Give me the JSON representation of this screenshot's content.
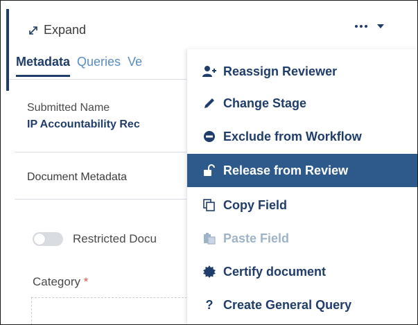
{
  "header": {
    "expand_label": "Expand",
    "icons": {
      "expand": "expand-arrows-icon",
      "more": "more-dots-icon",
      "caret": "chevron-down-icon"
    }
  },
  "tabs": [
    {
      "label": "Metadata",
      "active": true
    },
    {
      "label": "Queries",
      "active": false
    },
    {
      "label": "Ve",
      "active": false
    }
  ],
  "submitted": {
    "label": "Submitted Name",
    "value": "IP Accountability Rec"
  },
  "section_title": "Document Metadata",
  "restricted_toggle": {
    "label": "Restricted Docu",
    "on": false
  },
  "category": {
    "label": "Category",
    "required_mark": "*"
  },
  "menu": {
    "items": [
      {
        "label": "Reassign Reviewer",
        "icon": "user-plus-icon",
        "state": "normal"
      },
      {
        "label": "Change Stage",
        "icon": "pencil-icon",
        "state": "normal"
      },
      {
        "label": "Exclude from Workflow",
        "icon": "minus-circle-icon",
        "state": "normal"
      },
      {
        "label": "Release from Review",
        "icon": "unlock-icon",
        "state": "active"
      },
      {
        "label": "Copy Field",
        "icon": "copy-icon",
        "state": "normal"
      },
      {
        "label": "Paste Field",
        "icon": "paste-icon",
        "state": "disabled"
      },
      {
        "label": "Certify document",
        "icon": "certificate-icon",
        "state": "normal"
      },
      {
        "label": "Create General Query",
        "icon": "question-icon",
        "state": "normal"
      }
    ]
  },
  "colors": {
    "primary": "#1f3d6b",
    "active_item_bg": "#2e5a8b",
    "tab_inactive": "#5a8cc0",
    "disabled": "#9fb3c8",
    "required": "#d9534f"
  }
}
